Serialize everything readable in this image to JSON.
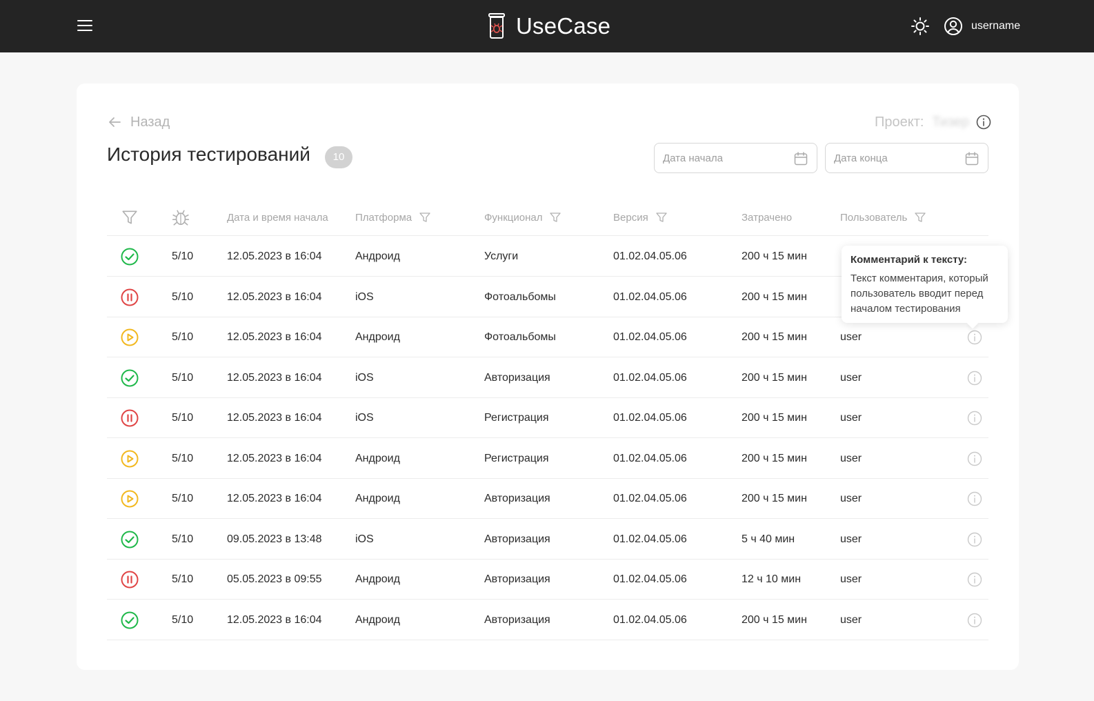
{
  "header": {
    "logo_text": "UseCase",
    "username": "username",
    "menu_icon": "hamburger-icon",
    "theme_icon": "sun-icon",
    "user_icon": "user-circle-icon"
  },
  "page": {
    "back_label": "Назад",
    "project_label": "Проект:",
    "project_value": "Тизер",
    "title": "История тестирований",
    "count": "10",
    "date_start_placeholder": "Дата начала",
    "date_end_placeholder": "Дата конца"
  },
  "table": {
    "columns": [
      "",
      "",
      "Дата и время начала",
      "Платформа",
      "Функционал",
      "Версия",
      "Затрачено",
      "Пользователь",
      ""
    ],
    "rows": [
      {
        "status": "passed",
        "bugs": "5/10",
        "date": "12.05.2023 в 16:04",
        "platform": "Андроид",
        "feature": "Услуги",
        "version": "01.02.04.05.06",
        "spent": "200 ч 15 мин",
        "user": ""
      },
      {
        "status": "paused",
        "bugs": "5/10",
        "date": "12.05.2023 в 16:04",
        "platform": "iOS",
        "feature": "Фотоальбомы",
        "version": "01.02.04.05.06",
        "spent": "200 ч 15 мин",
        "user": ""
      },
      {
        "status": "in-progress",
        "bugs": "5/10",
        "date": "12.05.2023 в 16:04",
        "platform": "Андроид",
        "feature": "Фотоальбомы",
        "version": "01.02.04.05.06",
        "spent": "200 ч 15 мин",
        "user": "user"
      },
      {
        "status": "passed",
        "bugs": "5/10",
        "date": "12.05.2023 в 16:04",
        "platform": "iOS",
        "feature": "Авторизация",
        "version": "01.02.04.05.06",
        "spent": "200 ч 15 мин",
        "user": "user"
      },
      {
        "status": "paused",
        "bugs": "5/10",
        "date": "12.05.2023 в 16:04",
        "platform": "iOS",
        "feature": "Регистрация",
        "version": "01.02.04.05.06",
        "spent": "200 ч 15 мин",
        "user": "user"
      },
      {
        "status": "in-progress",
        "bugs": "5/10",
        "date": "12.05.2023 в 16:04",
        "platform": "Андроид",
        "feature": "Регистрация",
        "version": "01.02.04.05.06",
        "spent": "200 ч 15 мин",
        "user": "user"
      },
      {
        "status": "in-progress",
        "bugs": "5/10",
        "date": "12.05.2023 в 16:04",
        "platform": "Андроид",
        "feature": "Авторизация",
        "version": "01.02.04.05.06",
        "spent": "200 ч 15 мин",
        "user": "user"
      },
      {
        "status": "passed",
        "bugs": "5/10",
        "date": "09.05.2023 в 13:48",
        "platform": "iOS",
        "feature": "Авторизация",
        "version": "01.02.04.05.06",
        "spent": "5 ч 40 мин",
        "user": "user"
      },
      {
        "status": "paused",
        "bugs": "5/10",
        "date": "05.05.2023 в 09:55",
        "platform": "Андроид",
        "feature": "Авторизация",
        "version": "01.02.04.05.06",
        "spent": "12 ч 10 мин",
        "user": "user"
      },
      {
        "status": "passed",
        "bugs": "5/10",
        "date": "12.05.2023 в 16:04",
        "platform": "Андроид",
        "feature": "Авторизация",
        "version": "01.02.04.05.06",
        "spent": "200 ч 15 мин",
        "user": "user"
      }
    ]
  },
  "tooltip": {
    "title": "Комментарий к тексту:",
    "text": "Текст комментария, который пользователь вводит перед началом тестирования"
  },
  "colors": {
    "passed": "#1fb84a",
    "paused": "#e04545",
    "in-progress": "#f2b81f",
    "header_bg": "#242424"
  }
}
